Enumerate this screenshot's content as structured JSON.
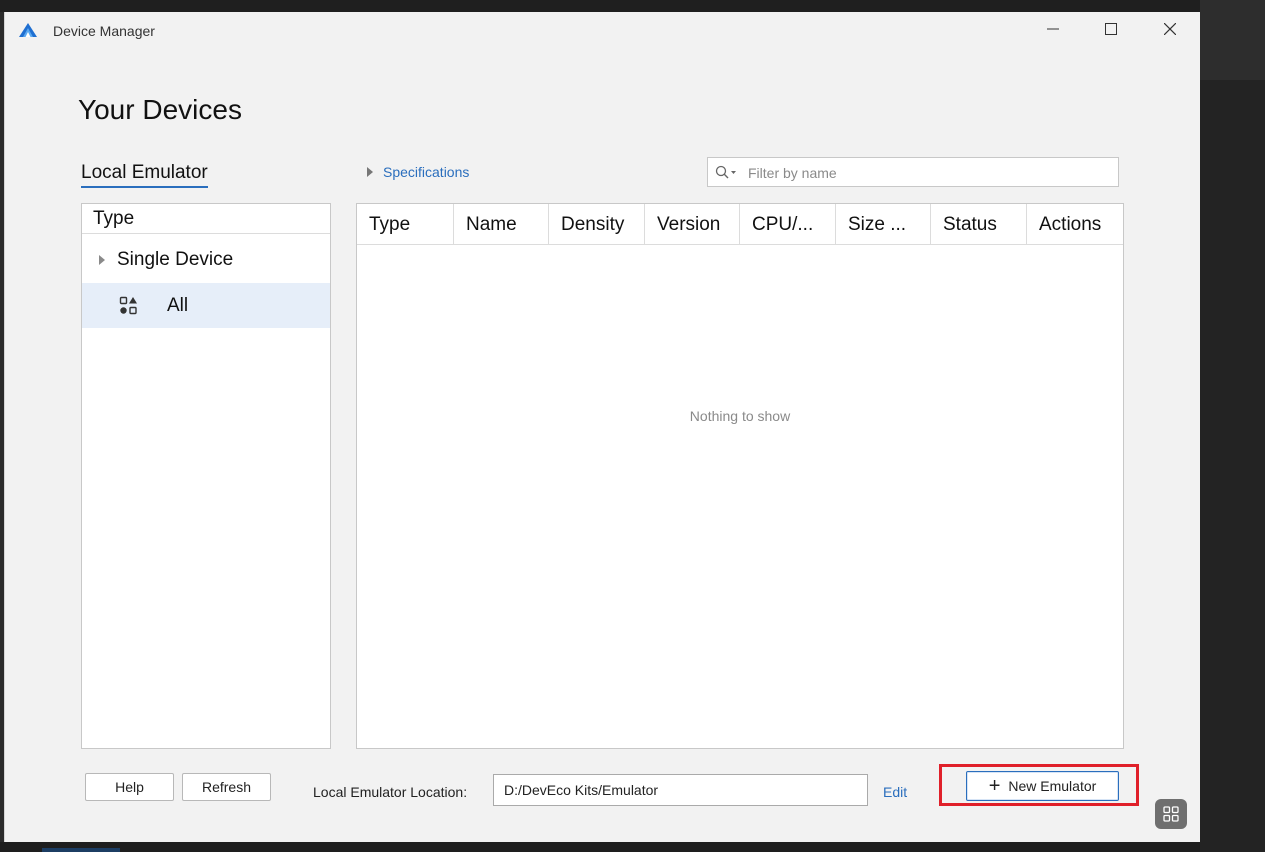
{
  "window": {
    "title": "Device Manager"
  },
  "page": {
    "title": "Your Devices"
  },
  "tabs": {
    "local_emulator": "Local Emulator"
  },
  "specifications": {
    "label": "Specifications"
  },
  "filter": {
    "placeholder": "Filter by name",
    "value": ""
  },
  "type_panel": {
    "header": "Type",
    "items": [
      {
        "label": "Single Device",
        "icon": "triangle-right-icon",
        "selected": false
      },
      {
        "label": "All",
        "icon": "shapes-icon",
        "selected": true
      }
    ]
  },
  "table": {
    "columns": [
      "Type",
      "Name",
      "Density",
      "Version",
      "CPU/...",
      "Size ...",
      "Status",
      "Actions"
    ],
    "rows": [],
    "empty_text": "Nothing to show"
  },
  "footer": {
    "help_label": "Help",
    "refresh_label": "Refresh",
    "location_label": "Local Emulator Location:",
    "location_value": "D:/DevEco Kits/Emulator",
    "edit_label": "Edit",
    "new_emulator_label": "New Emulator"
  },
  "colors": {
    "accent": "#2a6ebd",
    "highlight": "#e0202a",
    "selected_row": "#e6eef9",
    "window_bg": "#f2f2f2"
  }
}
